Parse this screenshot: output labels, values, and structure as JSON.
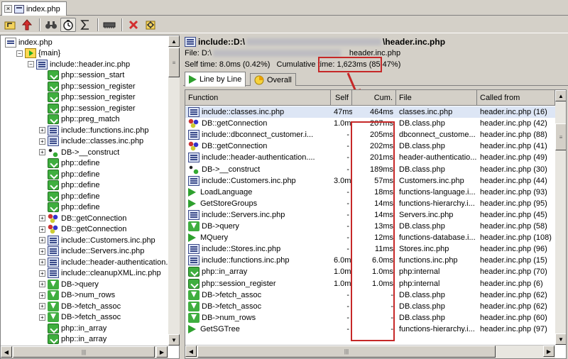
{
  "tab": {
    "close_glyph": "×",
    "title": "index.php"
  },
  "toolbar": {
    "icons": [
      "open-icon",
      "up-arrow-icon",
      "find-icon",
      "timer-icon",
      "sigma-icon",
      "memory-icon",
      "cancel-icon",
      "settings-icon"
    ]
  },
  "tree": [
    {
      "label": "index.php",
      "icon": "root",
      "depth": 0,
      "exp": ""
    },
    {
      "label": "{main}",
      "icon": "main",
      "depth": 1,
      "exp": "−"
    },
    {
      "label": "include::header.inc.php",
      "icon": "include",
      "depth": 2,
      "exp": "−"
    },
    {
      "label": "php::session_start",
      "icon": "green",
      "depth": 3,
      "exp": ""
    },
    {
      "label": "php::session_register",
      "icon": "green",
      "depth": 3,
      "exp": ""
    },
    {
      "label": "php::session_register",
      "icon": "green",
      "depth": 3,
      "exp": ""
    },
    {
      "label": "php::session_register",
      "icon": "green",
      "depth": 3,
      "exp": ""
    },
    {
      "label": "php::preg_match",
      "icon": "green",
      "depth": 3,
      "exp": ""
    },
    {
      "label": "include::functions.inc.php",
      "icon": "include",
      "depth": 3,
      "exp": "+"
    },
    {
      "label": "include::classes.inc.php",
      "icon": "include",
      "depth": 3,
      "exp": "+"
    },
    {
      "label": "DB->__construct",
      "icon": "ctor",
      "depth": 3,
      "exp": "+"
    },
    {
      "label": "php::define",
      "icon": "green",
      "depth": 3,
      "exp": ""
    },
    {
      "label": "php::define",
      "icon": "green",
      "depth": 3,
      "exp": ""
    },
    {
      "label": "php::define",
      "icon": "green",
      "depth": 3,
      "exp": ""
    },
    {
      "label": "php::define",
      "icon": "green",
      "depth": 3,
      "exp": ""
    },
    {
      "label": "php::define",
      "icon": "green",
      "depth": 3,
      "exp": ""
    },
    {
      "label": "DB::getConnection",
      "icon": "db",
      "depth": 3,
      "exp": "+"
    },
    {
      "label": "DB::getConnection",
      "icon": "db",
      "depth": 3,
      "exp": "+"
    },
    {
      "label": "include::Customers.inc.php",
      "icon": "include",
      "depth": 3,
      "exp": "+"
    },
    {
      "label": "include::Servers.inc.php",
      "icon": "include",
      "depth": 3,
      "exp": "+"
    },
    {
      "label": "include::header-authentication.inc",
      "icon": "include",
      "depth": 3,
      "exp": "+"
    },
    {
      "label": "include::cleanupXML.inc.php",
      "icon": "include",
      "depth": 3,
      "exp": "+"
    },
    {
      "label": "DB->query",
      "icon": "down",
      "depth": 3,
      "exp": "+"
    },
    {
      "label": "DB->num_rows",
      "icon": "down",
      "depth": 3,
      "exp": "+"
    },
    {
      "label": "DB->fetch_assoc",
      "icon": "down",
      "depth": 3,
      "exp": "+"
    },
    {
      "label": "DB->fetch_assoc",
      "icon": "down",
      "depth": 3,
      "exp": "+"
    },
    {
      "label": "php::in_array",
      "icon": "green",
      "depth": 3,
      "exp": ""
    },
    {
      "label": "php::in_array",
      "icon": "green",
      "depth": 3,
      "exp": ""
    }
  ],
  "details": {
    "title_prefix": "include::D:\\",
    "title_suffix": "\\header.inc.php",
    "file_label": "File: D:\\",
    "file_suffix": "header.inc.php",
    "self_time": "Self time: 8.0ms (0.42%)",
    "cumulative_label": "Cumulative time:",
    "cumulative_value": "1,623ms (85.47%)"
  },
  "view_tabs": [
    {
      "label": "Line by Line"
    },
    {
      "label": "Overall"
    }
  ],
  "columns": [
    "Function",
    "Self",
    "Cum.",
    "File",
    "Called from"
  ],
  "rows": [
    {
      "icon": "include",
      "fn": "include::classes.inc.php",
      "self": "47ms",
      "cum": "464ms",
      "file": "classes.inc.php",
      "from": "header.inc.php (16)"
    },
    {
      "icon": "db",
      "fn": "DB::getConnection",
      "self": "1.0ms",
      "cum": "207ms",
      "file": "DB.class.php",
      "from": "header.inc.php (42)"
    },
    {
      "icon": "include",
      "fn": "include::dbconnect_customer.i...",
      "self": "-",
      "cum": "205ms",
      "file": "dbconnect_custome...",
      "from": "header.inc.php (88)"
    },
    {
      "icon": "db",
      "fn": "DB::getConnection",
      "self": "-",
      "cum": "202ms",
      "file": "DB.class.php",
      "from": "header.inc.php (41)"
    },
    {
      "icon": "include",
      "fn": "include::header-authentication....",
      "self": "-",
      "cum": "201ms",
      "file": "header-authenticatio...",
      "from": "header.inc.php (49)"
    },
    {
      "icon": "ctor",
      "fn": "DB->__construct",
      "self": "-",
      "cum": "189ms",
      "file": "DB.class.php",
      "from": "header.inc.php (30)"
    },
    {
      "icon": "include",
      "fn": "include::Customers.inc.php",
      "self": "3.0ms",
      "cum": "57ms",
      "file": "Customers.inc.php",
      "from": "header.inc.php (44)"
    },
    {
      "icon": "play",
      "fn": "LoadLanguage",
      "self": "-",
      "cum": "18ms",
      "file": "functions-language.i...",
      "from": "header.inc.php (93)"
    },
    {
      "icon": "play",
      "fn": "GetStoreGroups",
      "self": "-",
      "cum": "14ms",
      "file": "functions-hierarchy.i...",
      "from": "header.inc.php (95)"
    },
    {
      "icon": "include",
      "fn": "include::Servers.inc.php",
      "self": "-",
      "cum": "14ms",
      "file": "Servers.inc.php",
      "from": "header.inc.php (45)"
    },
    {
      "icon": "down",
      "fn": "DB->query",
      "self": "-",
      "cum": "13ms",
      "file": "DB.class.php",
      "from": "header.inc.php (58)"
    },
    {
      "icon": "play",
      "fn": "MQuery",
      "self": "-",
      "cum": "12ms",
      "file": "functions-database.i...",
      "from": "header.inc.php (108)"
    },
    {
      "icon": "include",
      "fn": "include::Stores.inc.php",
      "self": "-",
      "cum": "11ms",
      "file": "Stores.inc.php",
      "from": "header.inc.php (96)"
    },
    {
      "icon": "include",
      "fn": "include::functions.inc.php",
      "self": "6.0ms",
      "cum": "6.0ms",
      "file": "functions.inc.php",
      "from": "header.inc.php (15)"
    },
    {
      "icon": "green",
      "fn": "php::in_array",
      "self": "1.0ms",
      "cum": "1.0ms",
      "file": "php:internal",
      "from": "header.inc.php (70)"
    },
    {
      "icon": "green",
      "fn": "php::session_register",
      "self": "1.0ms",
      "cum": "1.0ms",
      "file": "php:internal",
      "from": "header.inc.php (6)"
    },
    {
      "icon": "down",
      "fn": "DB->fetch_assoc",
      "self": "-",
      "cum": "-",
      "file": "DB.class.php",
      "from": "header.inc.php (62)"
    },
    {
      "icon": "down",
      "fn": "DB->fetch_assoc",
      "self": "-",
      "cum": "-",
      "file": "DB.class.php",
      "from": "header.inc.php (62)"
    },
    {
      "icon": "down",
      "fn": "DB->num_rows",
      "self": "-",
      "cum": "-",
      "file": "DB.class.php",
      "from": "header.inc.php (60)"
    },
    {
      "icon": "play",
      "fn": "GetSGTree",
      "self": "-",
      "cum": "-",
      "file": "functions-hierarchy.i...",
      "from": "header.inc.php (97)"
    }
  ],
  "colors": {
    "highlight": "#c62828",
    "selection": "#dde6f5"
  }
}
